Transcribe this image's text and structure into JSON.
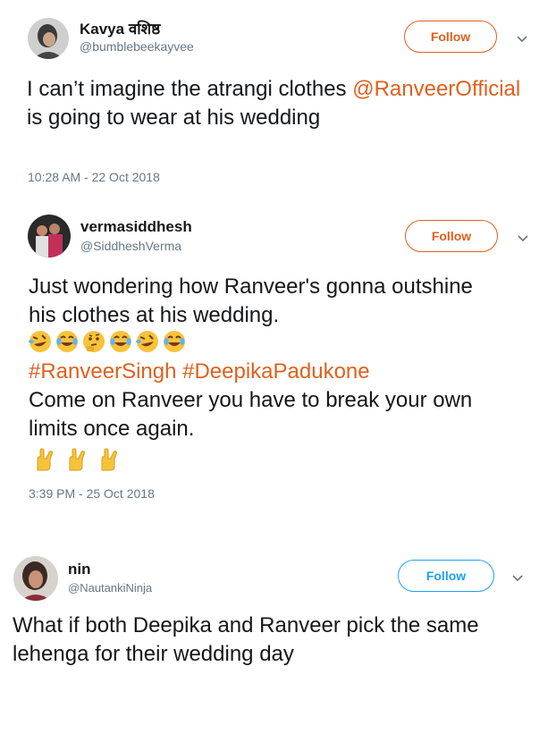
{
  "tweets": [
    {
      "name": "Kavya वशिष्ठ",
      "handle": "@bumblebeekayvee",
      "follow_label": "Follow",
      "text_before": "I can’t imagine the atrangi clothes ",
      "mention": "@RanveerOfficial",
      "text_after": " is going to wear at his wedding",
      "timestamp": "10:28 AM - 22 Oct 2018"
    },
    {
      "name": "vermasiddhesh",
      "handle": "@SiddheshVerma",
      "follow_label": "Follow",
      "line1": "Just wondering how Ranveer's gonna outshine his clothes at his wedding.",
      "emojis_1": [
        "rofl-emoji",
        "joy-emoji",
        "thinking-emoji",
        "joy-emoji",
        "rofl-emoji",
        "joy-emoji"
      ],
      "hashtag1": "#RanveerSingh",
      "hashtag2": "#DeepikaPadukone",
      "line2": "Come on Ranveer you have to break your own limits once again.",
      "emojis_2": [
        "horns-hand-emoji",
        "horns-hand-emoji",
        "horns-hand-emoji"
      ],
      "timestamp": "3:39 PM - 25 Oct 2018"
    },
    {
      "name": "nin",
      "handle": "@NautankiNinja",
      "follow_label": "Follow",
      "text": "What if both Deepika and Ranveer pick the same lehenga for their wedding day"
    }
  ],
  "colors": {
    "accent": "#e0601d",
    "follow_border_orange": "#e0601d",
    "follow_border_blue": "#1da1f2",
    "muted": "#657786"
  }
}
